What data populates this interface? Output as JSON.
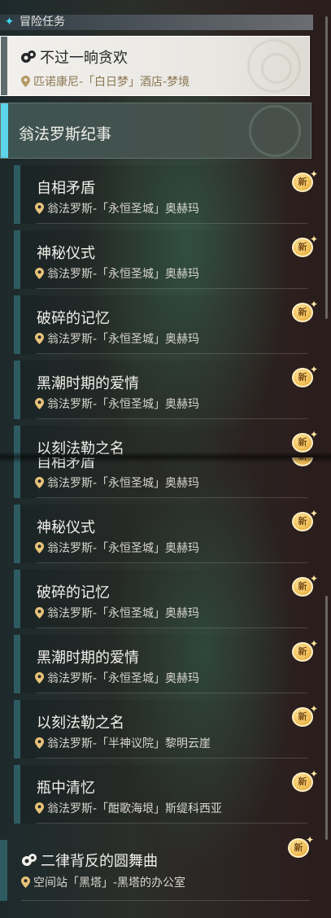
{
  "header": {
    "title": "冒险任务"
  },
  "current_quest": {
    "name": "不过一晌贪欢",
    "location": "匹诺康尼-「白日梦」酒店-梦境"
  },
  "group": {
    "label": "翁法罗斯纪事"
  },
  "badge_label": "新",
  "top_list": [
    {
      "name": "自相矛盾",
      "location": "翁法罗斯-「永恒圣城」奥赫玛"
    },
    {
      "name": "神秘仪式",
      "location": "翁法罗斯-「永恒圣城」奥赫玛"
    },
    {
      "name": "破碎的记忆",
      "location": "翁法罗斯-「永恒圣城」奥赫玛"
    },
    {
      "name": "黑潮时期的爱情",
      "location": "翁法罗斯-「永恒圣城」奥赫玛"
    },
    {
      "name": "以刻法勒之名",
      "location": ""
    }
  ],
  "bottom_list": [
    {
      "name": "自相矛盾",
      "location": "翁法罗斯-「永恒圣城」奥赫玛"
    },
    {
      "name": "神秘仪式",
      "location": "翁法罗斯-「永恒圣城」奥赫玛"
    },
    {
      "name": "破碎的记忆",
      "location": "翁法罗斯-「永恒圣城」奥赫玛"
    },
    {
      "name": "黑潮时期的爱情",
      "location": "翁法罗斯-「永恒圣城」奥赫玛"
    },
    {
      "name": "以刻法勒之名",
      "location": "翁法罗斯-「半神议院」黎明云崖"
    },
    {
      "name": "瓶中清忆",
      "location": "翁法罗斯-「酣歌海垠」斯缇科西亚"
    }
  ],
  "bottom_quest": {
    "name": "二律背反的圆舞曲",
    "location": "空间站「黑塔」-黑塔的办公室"
  }
}
